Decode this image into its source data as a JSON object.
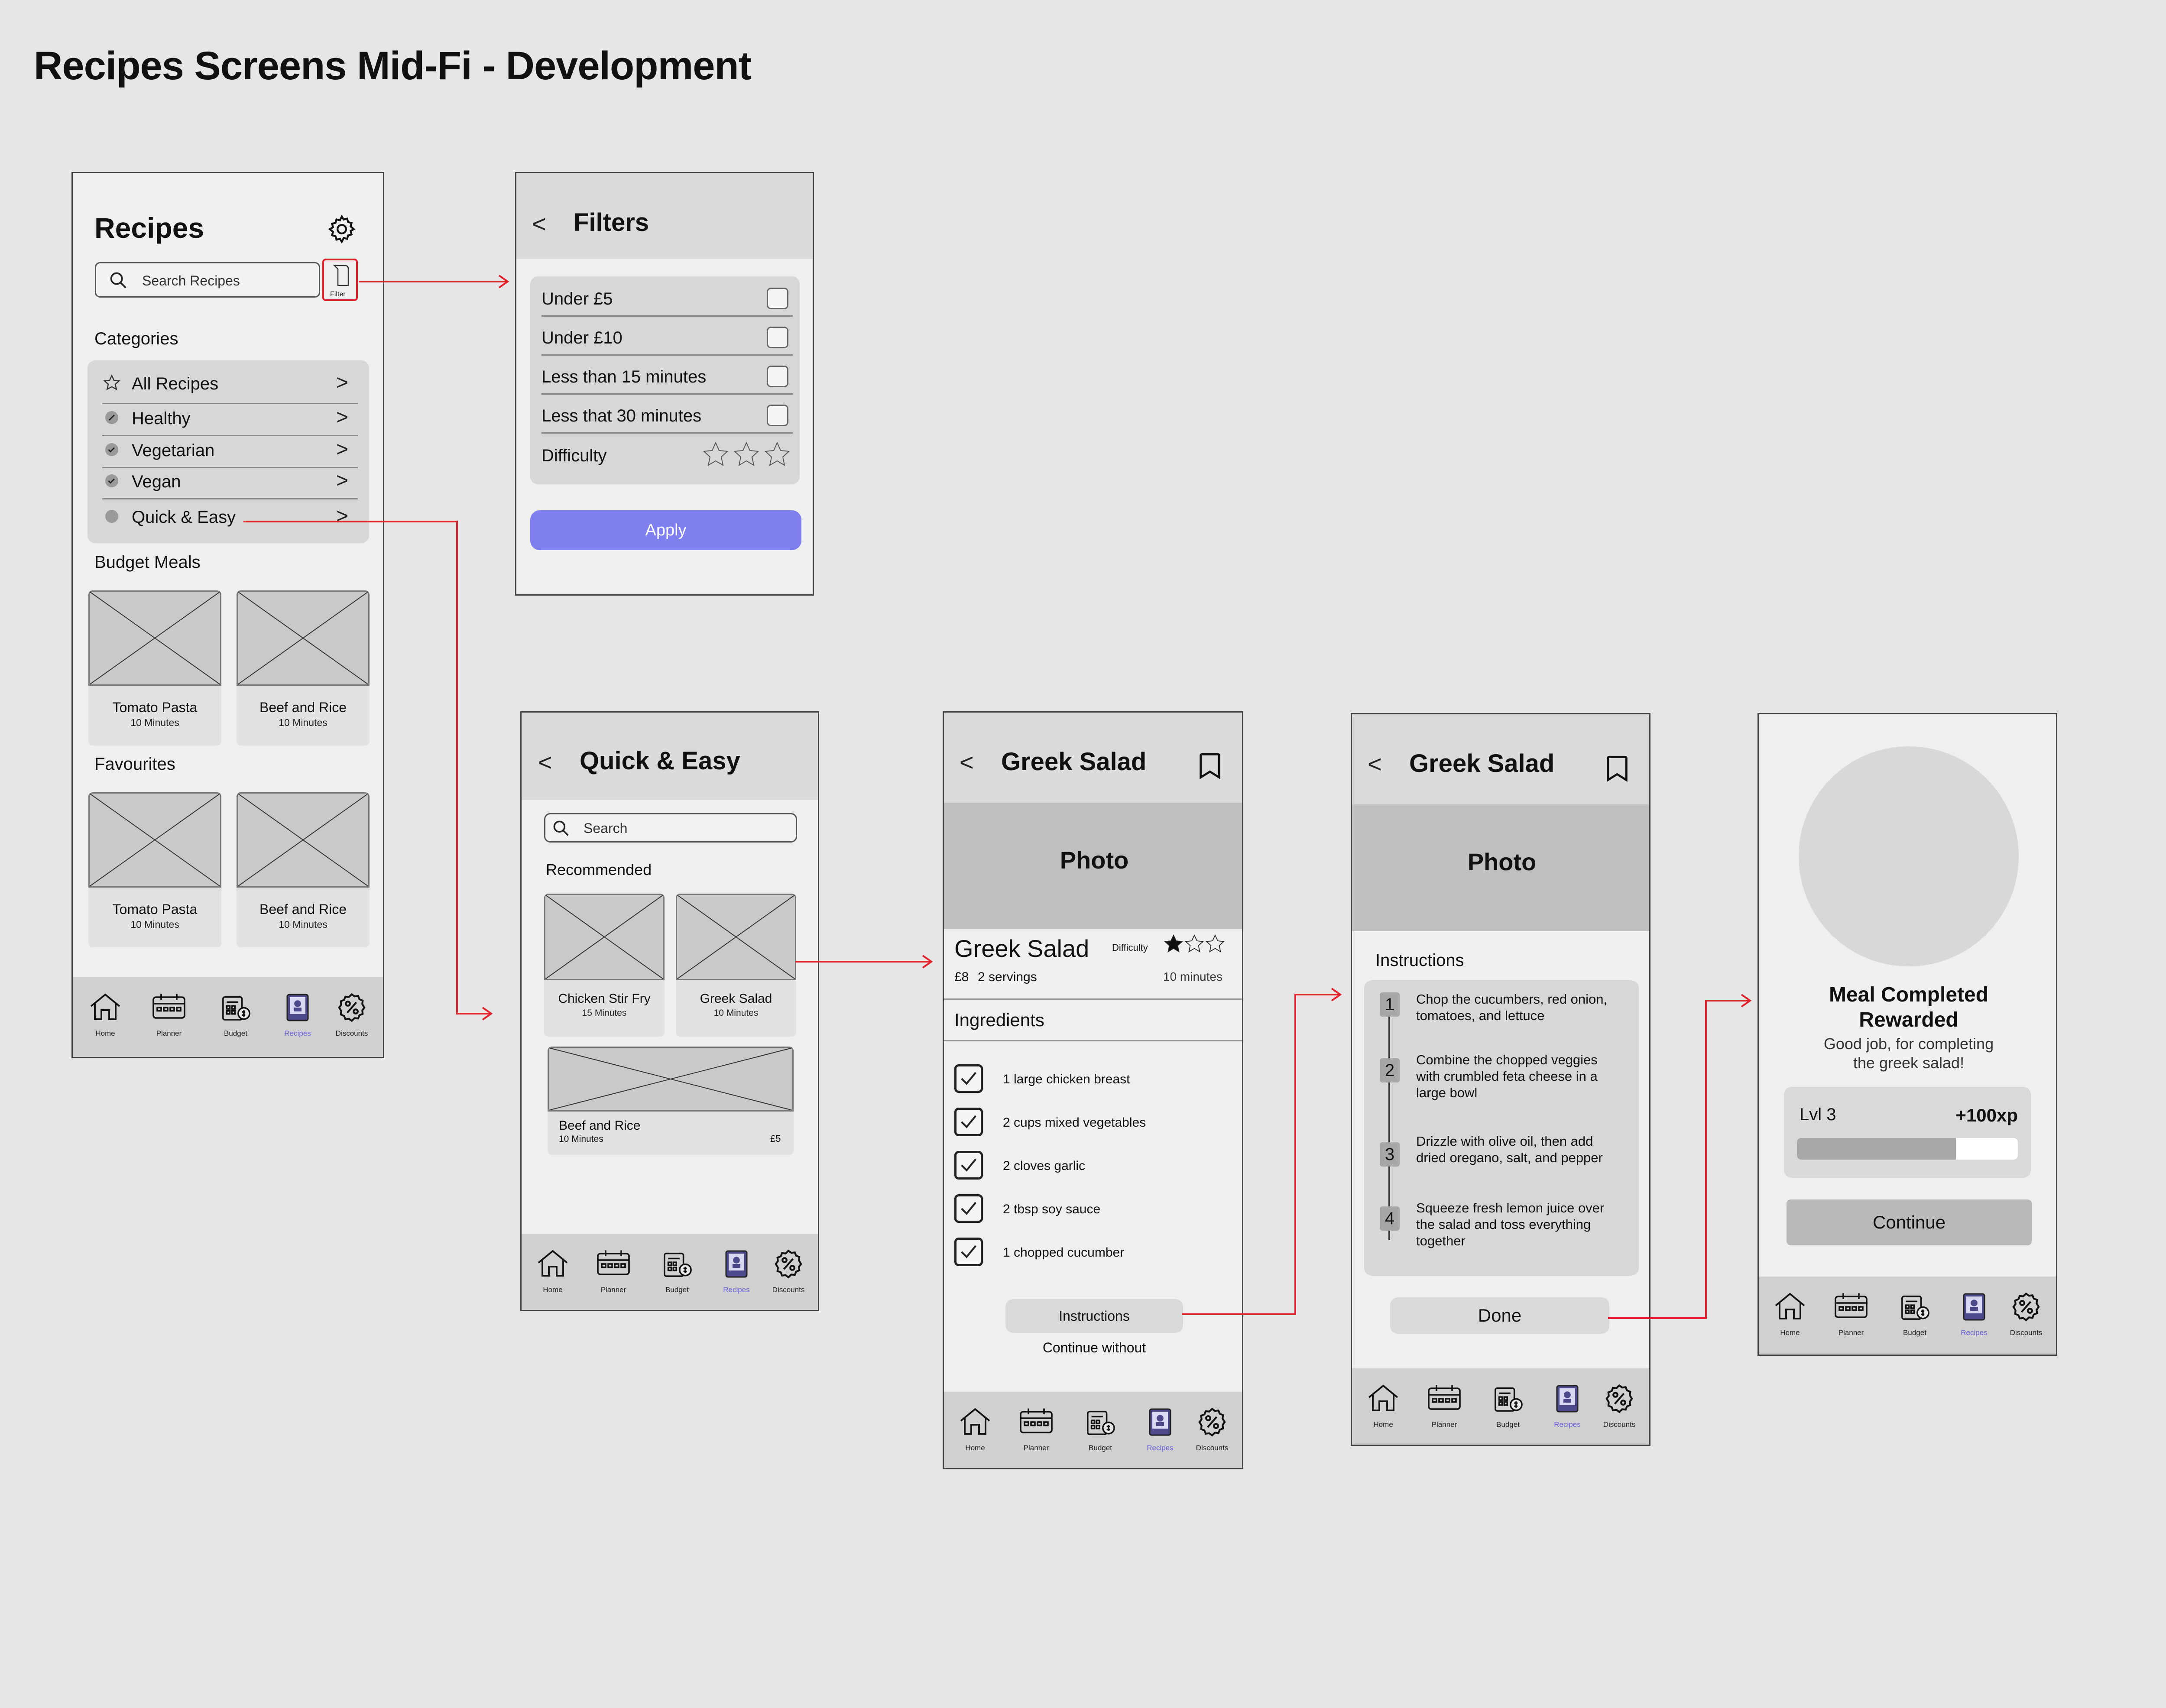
{
  "page_title": "Recipes Screens Mid-Fi - Development",
  "nav": {
    "items": [
      {
        "label": "Home",
        "icon": "home-icon"
      },
      {
        "label": "Planner",
        "icon": "planner-icon"
      },
      {
        "label": "Budget",
        "icon": "budget-icon"
      },
      {
        "label": "Recipes",
        "icon": "recipes-icon"
      },
      {
        "label": "Discounts",
        "icon": "discounts-icon"
      }
    ],
    "active_color": "#6a63d8"
  },
  "recipes": {
    "title": "Recipes",
    "search_placeholder": "Search Recipes",
    "filter_label": "Filter",
    "categories_heading": "Categories",
    "categories": [
      {
        "label": "All Recipes",
        "icon": "star-icon",
        "chevron": ">"
      },
      {
        "label": "Healthy",
        "icon": "leaf-icon",
        "chevron": ">"
      },
      {
        "label": "Vegetarian",
        "icon": "check-circle-icon",
        "chevron": ">"
      },
      {
        "label": "Vegan",
        "icon": "check-circle-icon",
        "chevron": ">"
      },
      {
        "label": "Quick & Easy",
        "icon": "dot-icon",
        "chevron": ">"
      }
    ],
    "budget_heading": "Budget Meals",
    "budget_meals": [
      {
        "name": "Tomato Pasta",
        "time": "10 Minutes"
      },
      {
        "name": "Beef and Rice",
        "time": "10 Minutes"
      }
    ],
    "favourites_heading": "Favourites",
    "favourites": [
      {
        "name": "Tomato Pasta",
        "time": "10 Minutes"
      },
      {
        "name": "Beef and Rice",
        "time": "10 Minutes"
      }
    ]
  },
  "filters": {
    "back": "<",
    "title": "Filters",
    "options": [
      "Under £5",
      "Under £10",
      "Less than 15 minutes",
      "Less that 30 minutes"
    ],
    "difficulty_label": "Difficulty",
    "apply_label": "Apply",
    "apply_color": "#7f7ff0"
  },
  "quick": {
    "back": "<",
    "title": "Quick & Easy",
    "search_placeholder": "Search",
    "recommended_heading": "Recommended",
    "items": [
      {
        "name": "Chicken Stir Fry",
        "time": "15 Minutes"
      },
      {
        "name": "Greek Salad",
        "time": "10 Minutes"
      }
    ],
    "wide_item": {
      "name": "Beef and Rice",
      "time": "10 Minutes",
      "price": "£5"
    }
  },
  "greek": {
    "back": "<",
    "title": "Greek Salad",
    "photo_label": "Photo",
    "name": "Greek Salad",
    "difficulty_label": "Difficulty",
    "difficulty_rating": 1,
    "difficulty_max": 3,
    "price": "£8",
    "servings": "2 servings",
    "time": "10 minutes",
    "ingredients_heading": "Ingredients",
    "ingredients": [
      "1 large chicken breast",
      "2 cups mixed vegetables",
      "2 cloves garlic",
      "2 tbsp soy sauce",
      "1 chopped cucumber"
    ],
    "instructions_button": "Instructions",
    "continue_without": "Continue without"
  },
  "instructions": {
    "back": "<",
    "title": "Greek Salad",
    "photo_label": "Photo",
    "heading": "Instructions",
    "steps": [
      {
        "num": "1",
        "text": [
          "Chop the cucumbers, red onion,",
          "tomatoes, and lettuce"
        ]
      },
      {
        "num": "2",
        "text": [
          "Combine the chopped veggies",
          "with crumbled feta cheese in a",
          "large bowl"
        ]
      },
      {
        "num": "3",
        "text": [
          "Drizzle with olive oil, then add",
          "dried oregano, salt, and pepper"
        ]
      },
      {
        "num": "4",
        "text": [
          "Squeeze fresh lemon juice over",
          "the salad and toss everything",
          "together"
        ]
      }
    ],
    "done_label": "Done"
  },
  "completed": {
    "title_line1": "Meal Completed",
    "title_line2": "Rewarded",
    "sub_line1": "Good job, for completing",
    "sub_line2": "the greek salad!",
    "level": "Lvl 3",
    "xp": "+100xp",
    "progress": 0.72,
    "continue_label": "Continue"
  },
  "colors": {
    "flow_arrow": "#e0202a",
    "page_bg": "#e6e6e6"
  }
}
